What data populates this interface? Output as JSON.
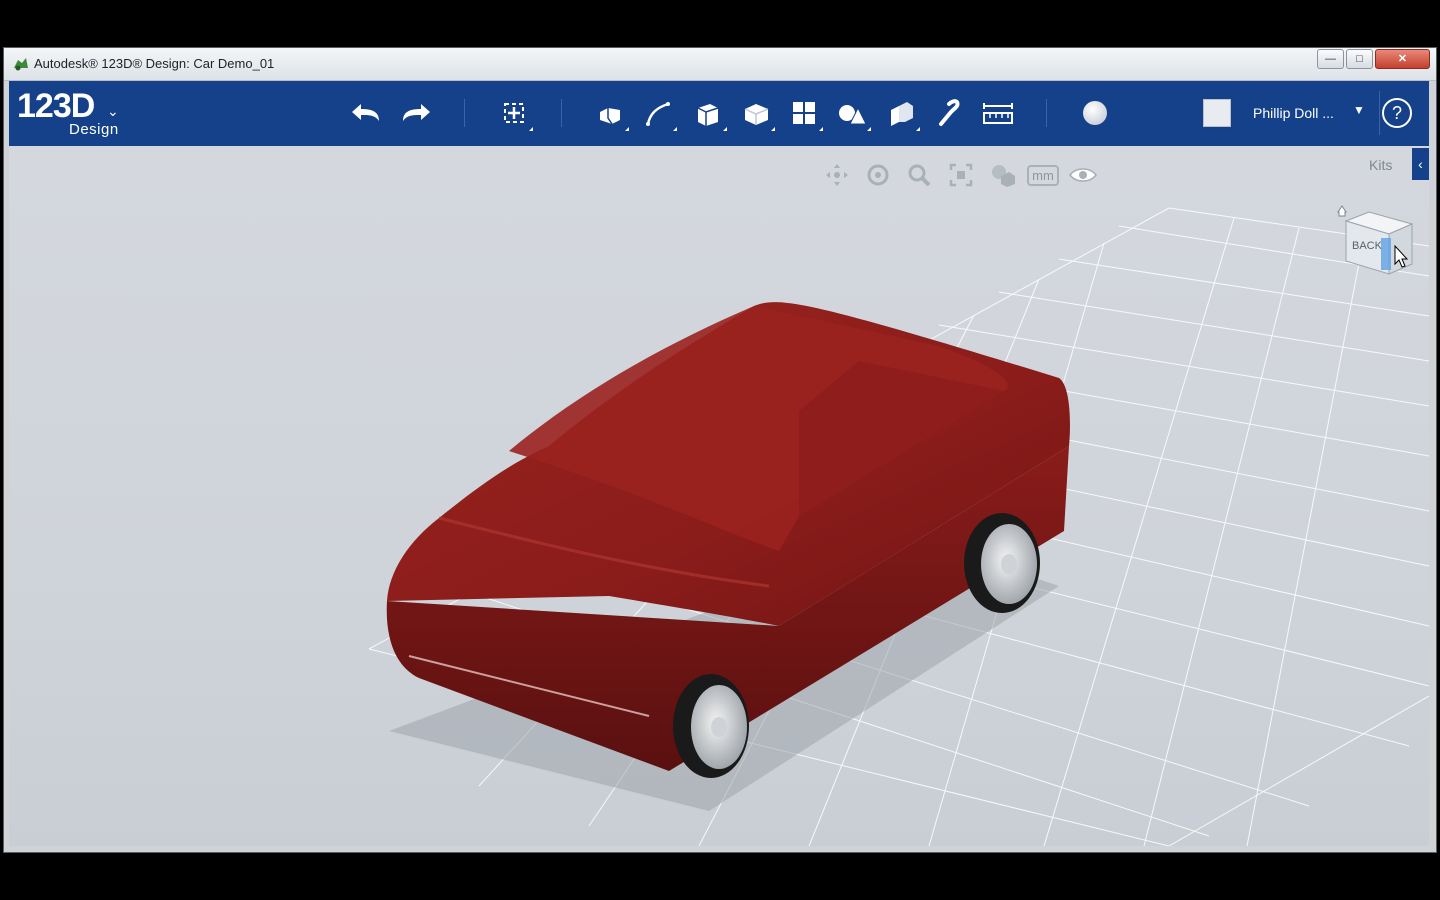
{
  "window": {
    "title": "Autodesk® 123D® Design: Car Demo_01",
    "controls": {
      "minimize": "—",
      "maximize": "□",
      "close": "✕"
    }
  },
  "logo": {
    "main": "123D",
    "sub": "Design"
  },
  "toolbar": {
    "tools": [
      {
        "name": "undo-icon"
      },
      {
        "name": "redo-icon"
      },
      {
        "name": "transform-icon"
      },
      {
        "name": "primitives-icon"
      },
      {
        "name": "sketch-icon"
      },
      {
        "name": "construct-icon"
      },
      {
        "name": "modify-icon"
      },
      {
        "name": "pattern-icon"
      },
      {
        "name": "grouping-icon"
      },
      {
        "name": "combine-icon"
      },
      {
        "name": "snap-icon"
      },
      {
        "name": "measure-icon"
      },
      {
        "name": "material-icon"
      }
    ]
  },
  "user": {
    "name": "Phillip Doll ..."
  },
  "help": {
    "label": "?"
  },
  "view_controls": {
    "units": "mm",
    "icons": [
      "pan-icon",
      "orbit-icon",
      "zoom-icon",
      "fit-icon",
      "view-material-icon",
      "units-button",
      "visibility-icon"
    ]
  },
  "kits": {
    "label": "Kits",
    "toggle": "‹"
  },
  "viewcube": {
    "face": "BACK"
  },
  "colors": {
    "toolbar": "#14418a",
    "car_body": "#8a1c1a",
    "viewport": "#d0d5db",
    "grid": "#ffffff"
  }
}
